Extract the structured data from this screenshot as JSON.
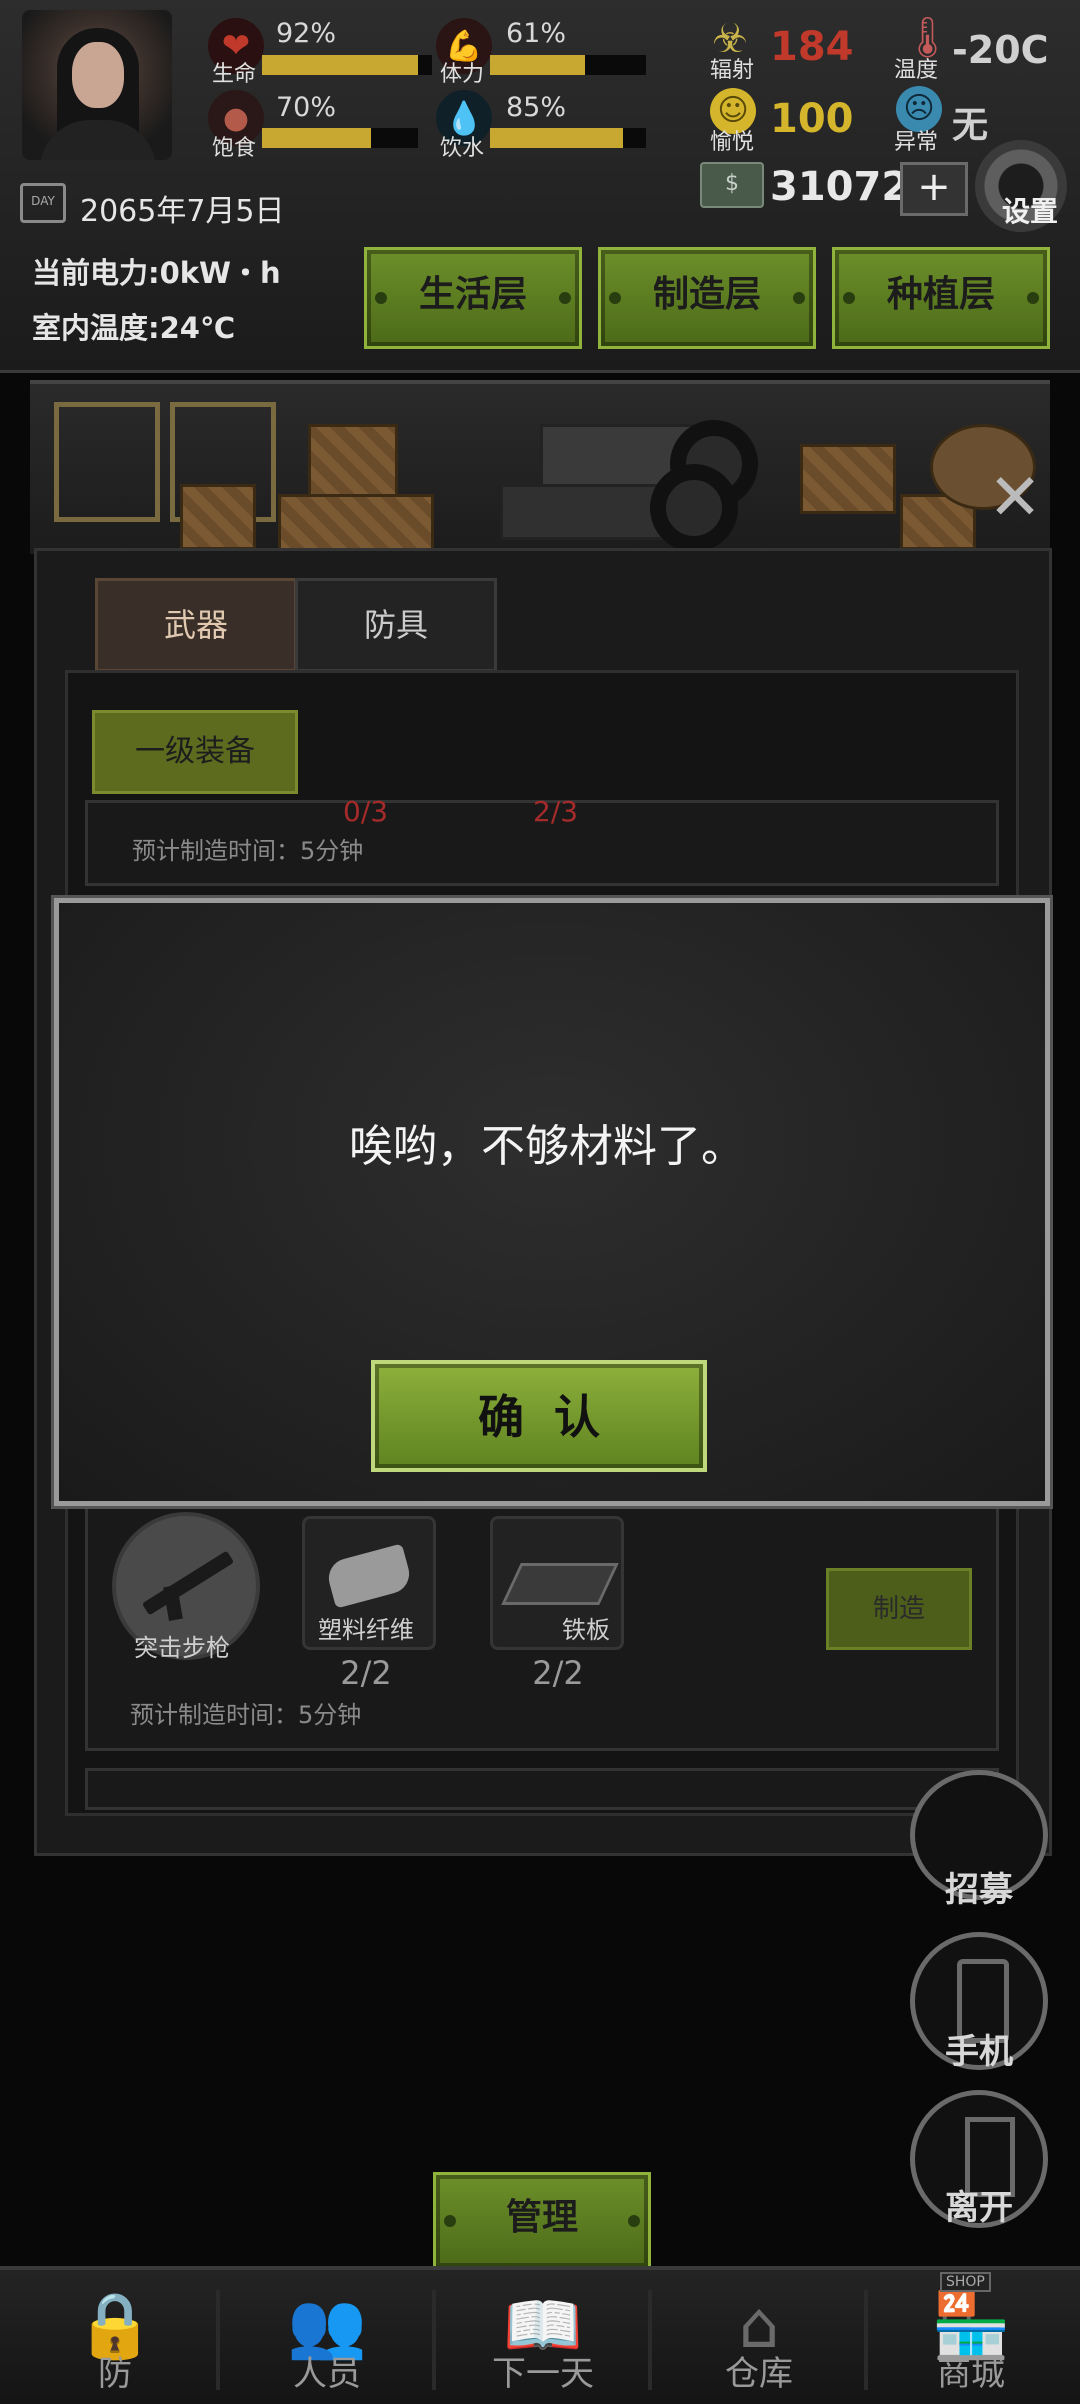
{
  "stats": [
    {
      "name": "生命",
      "percent": "92%",
      "level": 0.92,
      "icon": "heart-icon",
      "color": "#c0392b"
    },
    {
      "name": "体力",
      "percent": "61%",
      "level": 0.61,
      "icon": "muscle-icon",
      "color": "#c0392b"
    },
    {
      "name": "饱食",
      "percent": "70%",
      "level": 0.7,
      "icon": "stomach-icon",
      "color": "#b35a4a"
    },
    {
      "name": "饮水",
      "percent": "85%",
      "level": 0.85,
      "icon": "water-drop-icon",
      "color": "#3a8ab0"
    }
  ],
  "resources": {
    "radiation": {
      "label": "辐射",
      "value": "184",
      "color": "#c0392b"
    },
    "temperature": {
      "label": "温度",
      "value": "-20C",
      "color": "#d0d0d0"
    },
    "joy": {
      "label": "愉悦",
      "value": "100",
      "color": "#d4b52b"
    },
    "abnormal": {
      "label": "异常",
      "value": "无",
      "color": "#d0d0d0"
    },
    "money": {
      "value": "31072",
      "plus": "+"
    }
  },
  "date": {
    "badge": "DAY",
    "text": "2065年7月5日"
  },
  "settings": {
    "label": "设置"
  },
  "info": {
    "power": "当前电力:0kW・h",
    "indoor_temp": "室内温度:24℃"
  },
  "layers": [
    "生活层",
    "制造层",
    "种植层"
  ],
  "crafting": {
    "tabs": [
      "武器",
      "防具"
    ],
    "level_tag": "一级装备",
    "partial_counts": [
      "0/3",
      "2/3"
    ],
    "est_time_1": "预计制造时间：5分钟",
    "item_name": "突击步枪",
    "materials": [
      {
        "name": "塑料纤维",
        "count": "2/2"
      },
      {
        "name": "铁板",
        "count": "2/2"
      }
    ],
    "craft_button": "制造",
    "est_time_2": "预计制造时间：5分钟"
  },
  "modal": {
    "message": "唉哟，不够材料了。",
    "confirm": "确认"
  },
  "side_buttons": [
    "招募",
    "手机",
    "离开"
  ],
  "manage_button": "管理",
  "nav": [
    {
      "label": "防",
      "icon": "lock-icon"
    },
    {
      "label": "人员",
      "icon": "people-icon"
    },
    {
      "label": "下一天",
      "icon": "book-icon"
    },
    {
      "label": "仓库",
      "icon": "warehouse-icon"
    },
    {
      "label": "商城",
      "icon": "shop-icon",
      "badge": "SHOP"
    }
  ]
}
